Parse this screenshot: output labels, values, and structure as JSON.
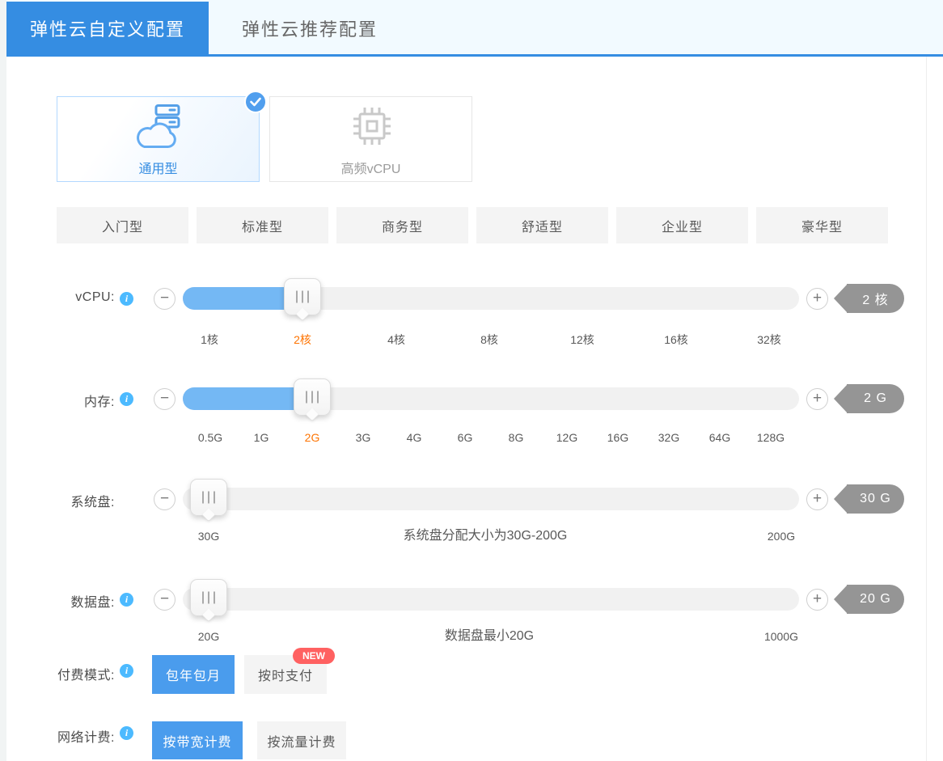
{
  "tabs": [
    {
      "label": "弹性云自定义配置",
      "active": true
    },
    {
      "label": "弹性云推荐配置",
      "active": false
    }
  ],
  "instance_types": [
    {
      "label": "通用型",
      "selected": true,
      "icon": "cloud-server-icon"
    },
    {
      "label": "高频vCPU",
      "selected": false,
      "icon": "cpu-chip-icon"
    }
  ],
  "presets": [
    "入门型",
    "标准型",
    "商务型",
    "舒适型",
    "企业型",
    "豪华型"
  ],
  "sliders": [
    {
      "label": "vCPU:",
      "has_info": true,
      "badge": "2 核",
      "ticks": [
        "1核",
        "2核",
        "4核",
        "8核",
        "12核",
        "16核",
        "32核"
      ],
      "active_tick": "2核"
    },
    {
      "label": "内存:",
      "has_info": true,
      "badge": "2 G",
      "ticks": [
        "0.5G",
        "1G",
        "2G",
        "3G",
        "4G",
        "6G",
        "8G",
        "12G",
        "16G",
        "32G",
        "64G",
        "128G"
      ],
      "active_tick": "2G"
    },
    {
      "label": "系统盘:",
      "has_info": false,
      "badge": "30 G",
      "min_label": "30G",
      "hint": "系统盘分配大小为30G-200G",
      "max_label": "200G"
    },
    {
      "label": "数据盘:",
      "has_info": true,
      "badge": "20 G",
      "min_label": "20G",
      "hint": "数据盘最小20G",
      "max_label": "1000G"
    }
  ],
  "payment": {
    "label": "付费模式:",
    "options": [
      {
        "label": "包年包月",
        "selected": true
      },
      {
        "label": "按时支付",
        "selected": false,
        "badge": "NEW"
      }
    ]
  },
  "network": {
    "label": "网络计费:",
    "options": [
      {
        "label": "按带宽计费",
        "selected": true
      },
      {
        "label": "按流量计费",
        "selected": false
      }
    ]
  },
  "colors": {
    "tab_blue": "#358de2",
    "option_blue": "#4a9ced",
    "fill_blue": "#74b8f4",
    "badge_gray": "#959595",
    "orange": "#fe7402",
    "new_red": "#ff6161",
    "info_blue": "#4cbaff",
    "card_selected_border": "#b2d8ff"
  }
}
